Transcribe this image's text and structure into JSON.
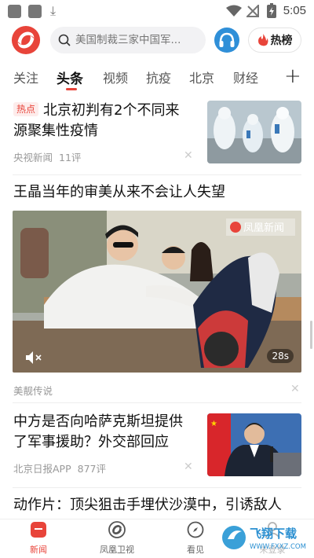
{
  "status_bar": {
    "time": "5:05"
  },
  "header": {
    "search_placeholder": "美国制裁三家中国军...",
    "hot_label": "热榜"
  },
  "tabs": [
    "关注",
    "头条",
    "视频",
    "抗疫",
    "北京",
    "财经"
  ],
  "active_tab": "头条",
  "feed": [
    {
      "badge": "热点",
      "title_line1": "北京初判有2个不同来",
      "title_line2": "源聚集性疫情",
      "source": "央视新闻",
      "comments": "11评"
    },
    {
      "title": "王晶当年的审美从来不会让人失望",
      "duration": "28s",
      "video_watermark": "凤凰新闻",
      "source": "美靓传说"
    },
    {
      "title_line1": "中方是否向哈萨克斯坦提供",
      "title_line2": "了军事援助？外交部回应",
      "source": "北京日报APP",
      "comments": "877评"
    },
    {
      "title": "动作片：顶尖狙击手埋伏沙漠中，引诱敌人"
    }
  ],
  "bottom_nav": [
    {
      "label": "新闻",
      "icon": "news-icon"
    },
    {
      "label": "凤凰卫视",
      "icon": "phoenix-tv-icon"
    },
    {
      "label": "看见",
      "icon": "compass-icon"
    },
    {
      "label": "未登录",
      "icon": "user-icon"
    }
  ],
  "watermark": {
    "text": "飞翔下载",
    "url": "WWW.FXXZ.COM"
  },
  "colors": {
    "accent": "#e8443a",
    "audio_blue": "#2f8fd8"
  }
}
